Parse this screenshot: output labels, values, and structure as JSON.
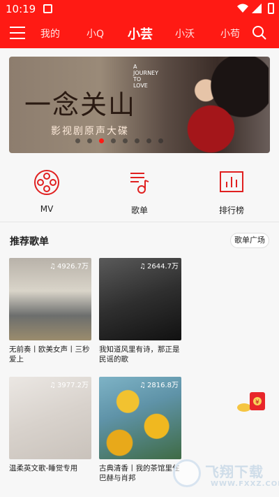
{
  "status_bar": {
    "time": "10:19"
  },
  "header": {
    "tabs": [
      {
        "label": "我的"
      },
      {
        "label": "小Q"
      },
      {
        "label": "小芸"
      },
      {
        "label": "小沃"
      },
      {
        "label": "小苟"
      }
    ],
    "active_tab": "小芸"
  },
  "banner": {
    "title": "一念关山",
    "subtitle": "影视剧原声大碟",
    "small_text": "A JOURNEY TO LOVE",
    "dots": 8,
    "active_dot": 2
  },
  "features": [
    {
      "label": "MV",
      "icon": "film-reel-icon"
    },
    {
      "label": "歌单",
      "icon": "playlist-icon"
    },
    {
      "label": "排行榜",
      "icon": "chart-icon"
    }
  ],
  "section": {
    "title": "推荐歌单",
    "more_button": "歌单广场"
  },
  "playlists": [
    {
      "plays": "4926.7万",
      "title": "无前奏丨欧美女声丨三秒爱上"
    },
    {
      "plays": "2644.7万",
      "title": "我知道风里有诗，那正是民谣的歌"
    },
    {
      "plays": "3977.2万",
      "title": "温柔英文歌-睡觉专用"
    },
    {
      "plays": "2816.8万",
      "title": "古典清香丨我的茶馆里住巴赫与肖邦"
    }
  ],
  "watermark": {
    "text": "飞翔下载",
    "url": "WWW.FXXZ.COM"
  },
  "colors": {
    "brand_red": "#ff1a14",
    "icon_red": "#e02020"
  }
}
